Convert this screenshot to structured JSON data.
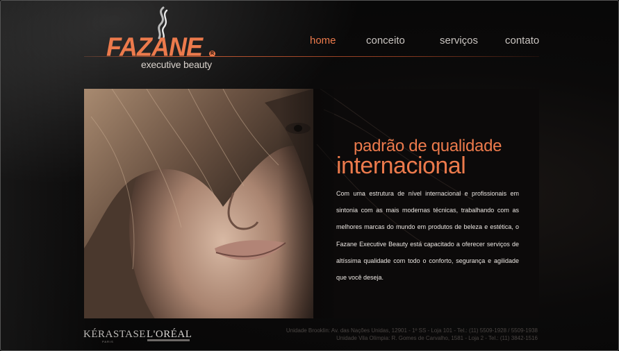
{
  "brand": {
    "name": "FAZANE",
    "registered_mark": "R",
    "tagline": "executive beauty"
  },
  "nav": {
    "items": [
      {
        "label": "home",
        "active": true
      },
      {
        "label": "conceito",
        "active": false
      },
      {
        "label": "serviços",
        "active": false
      },
      {
        "label": "contato",
        "active": false
      }
    ]
  },
  "hero": {
    "headline_line1": "padrão de qualidade",
    "headline_line2": "internacional",
    "body": "Com uma estrutura de nível internacional e profissionais em sintonia com as mais modernas técnicas, trabalhando com as melhores marcas do mundo em produtos de beleza e estética, o Fazane Executive Beauty está capacitado a oferecer serviços de altíssima qualidade com todo o conforto, segurança e agilidade que você deseja."
  },
  "partners": {
    "kerastase": "KÉRASTASE",
    "kerastase_sub": "PARIS",
    "loreal": "L'ORÉAL"
  },
  "footer": {
    "address_line1": "Unidade Brooklin: Av. das Nações Unidas, 12901 - 1º SS - Loja 101 - Tel.: (11) 5509-1928 / 5509-1938",
    "address_line2": "Unidade Vila Olímpia: R. Gomes de Carvalho, 1581 - Loja 2 - Tel.: (11) 3842-1516"
  },
  "colors": {
    "accent": "#ec7a4c",
    "background": "#070707",
    "text": "#ece7e3"
  }
}
